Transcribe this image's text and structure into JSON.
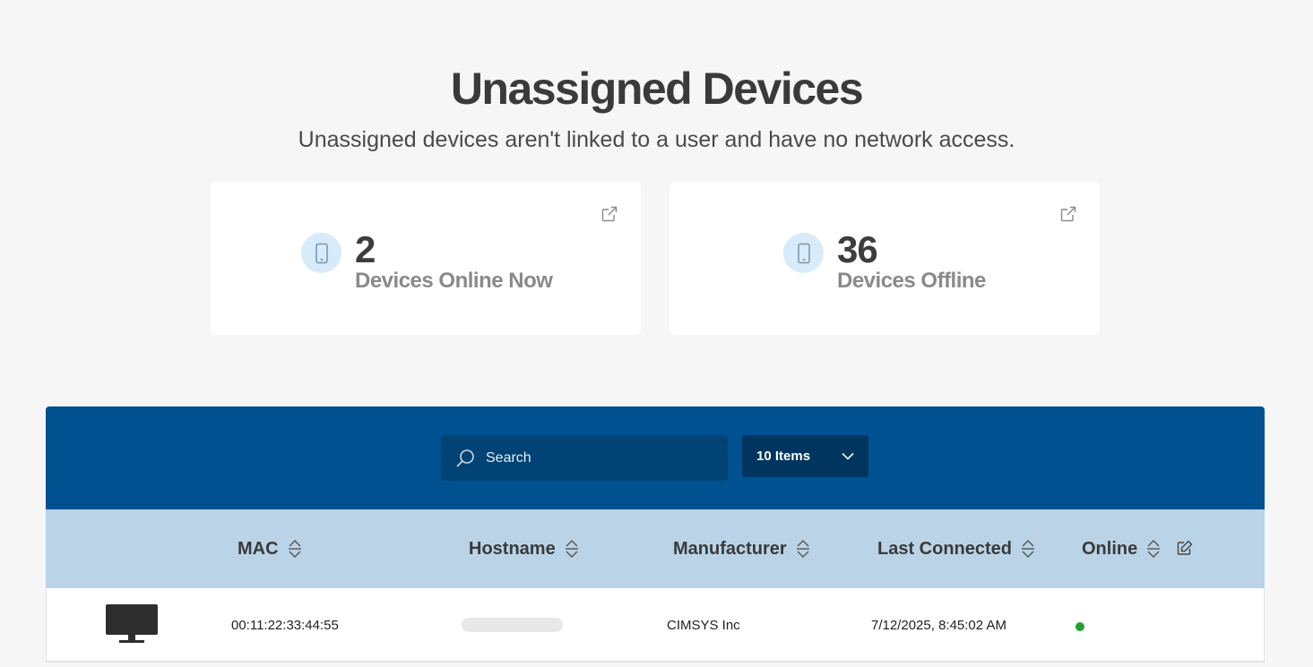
{
  "header": {
    "title": "Unassigned Devices",
    "subtitle": "Unassigned devices aren't linked to a user and have no network access."
  },
  "stats": [
    {
      "value": "2",
      "label": "Devices Online Now",
      "icon": "mobile-phone-icon"
    },
    {
      "value": "36",
      "label": "Devices Offline",
      "icon": "mobile-phone-icon"
    }
  ],
  "toolbar": {
    "search_placeholder": "Search",
    "items_per_page": "10 Items"
  },
  "table": {
    "columns": [
      "MAC",
      "Hostname",
      "Manufacturer",
      "Last Connected",
      "Online"
    ],
    "rows": [
      {
        "device_type": "monitor-icon",
        "mac": "00:11:22:33:44:55",
        "hostname": "",
        "manufacturer": "CIMSYS Inc",
        "last_connected": "7/12/2025, 8:45:02 AM",
        "online": true
      }
    ]
  },
  "colors": {
    "toolbar_bg": "#00518f",
    "header_bg": "#bad3e7",
    "online_status": "#1fa12c",
    "stat_icon_bg": "#d8ebfa"
  }
}
